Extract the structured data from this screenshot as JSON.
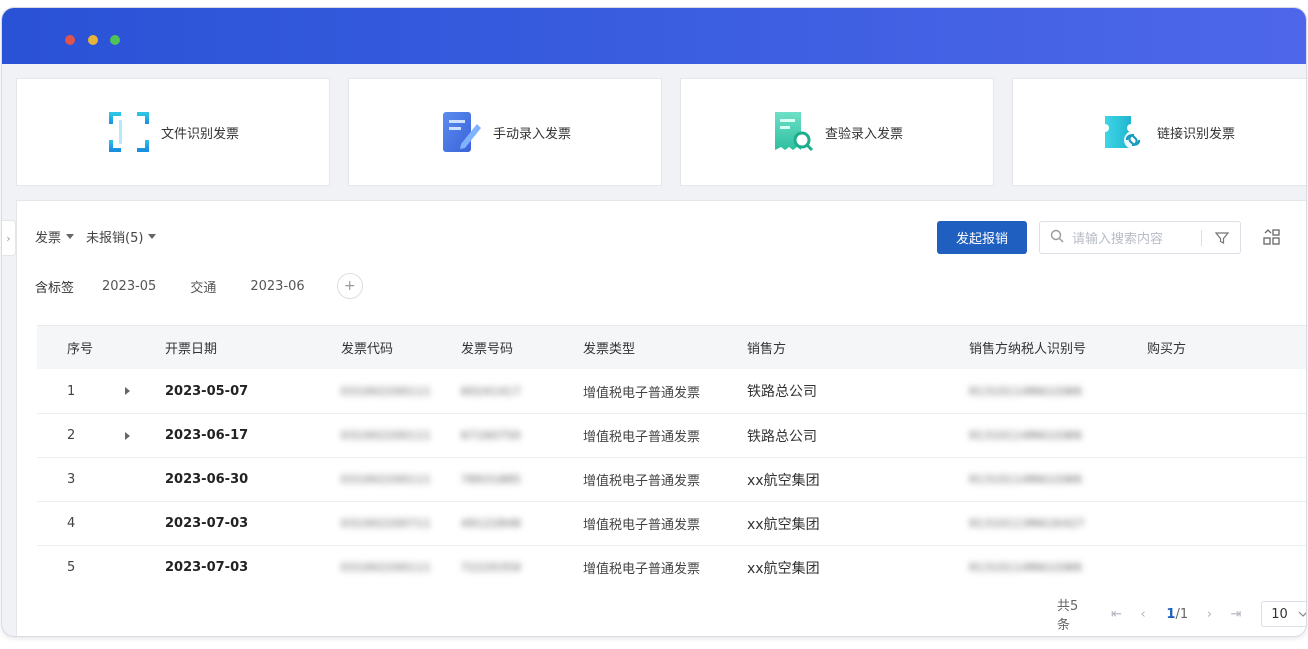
{
  "cards": [
    {
      "label": "文件识别发票",
      "icon": "scan-frame-icon"
    },
    {
      "label": "手动录入发票",
      "icon": "edit-document-icon"
    },
    {
      "label": "查验录入发票",
      "icon": "verify-receipt-icon"
    },
    {
      "label": "链接识别发票",
      "icon": "link-ticket-icon"
    }
  ],
  "filters": {
    "type": "发票",
    "status": "未报销(5)"
  },
  "toolbar": {
    "start_button": "发起报销",
    "search_placeholder": "请输入搜索内容"
  },
  "tags": {
    "title": "含标签",
    "items": [
      "2023-05",
      "交通",
      "2023-06"
    ],
    "add": "+"
  },
  "table": {
    "headers": [
      "序号",
      "开票日期",
      "发票代码",
      "发票号码",
      "发票类型",
      "销售方",
      "销售方纳税人识别号",
      "购买方"
    ],
    "rows": [
      {
        "idx": "1",
        "expandable": true,
        "date": "2023-05-07",
        "code": "031002200111",
        "number": "60241417",
        "type": "增值税电子普通发票",
        "seller": "铁路总公司",
        "tax_id": "91310114MA1GW6",
        "buyer": ""
      },
      {
        "idx": "2",
        "expandable": true,
        "date": "2023-06-17",
        "code": "031002200111",
        "number": "67160750",
        "type": "增值税电子普通发票",
        "seller": "铁路总公司",
        "tax_id": "91310114MA1GW6",
        "buyer": ""
      },
      {
        "idx": "3",
        "expandable": false,
        "date": "2023-06-30",
        "code": "031002200111",
        "number": "78931885",
        "type": "增值税电子普通发票",
        "seller": "xx航空集团",
        "tax_id": "91310114MA1GW6",
        "buyer": ""
      },
      {
        "idx": "4",
        "expandable": false,
        "date": "2023-07-03",
        "code": "031002200711",
        "number": "49122848",
        "type": "增值税电子普通发票",
        "seller": "xx航空集团",
        "tax_id": "91310113MA1K427",
        "buyer": ""
      },
      {
        "idx": "5",
        "expandable": false,
        "date": "2023-07-03",
        "code": "031002200111",
        "number": "72220359",
        "type": "增值税电子普通发票",
        "seller": "xx航空集团",
        "tax_id": "91310114MA1GW6",
        "buyer": ""
      }
    ]
  },
  "pager": {
    "total": "共5条",
    "current": "1",
    "pages": "/1",
    "size": "10"
  },
  "colors": {
    "accent": "#1f5fbf",
    "titlebar_start": "#2a52d6",
    "titlebar_end": "#4e67ea"
  }
}
